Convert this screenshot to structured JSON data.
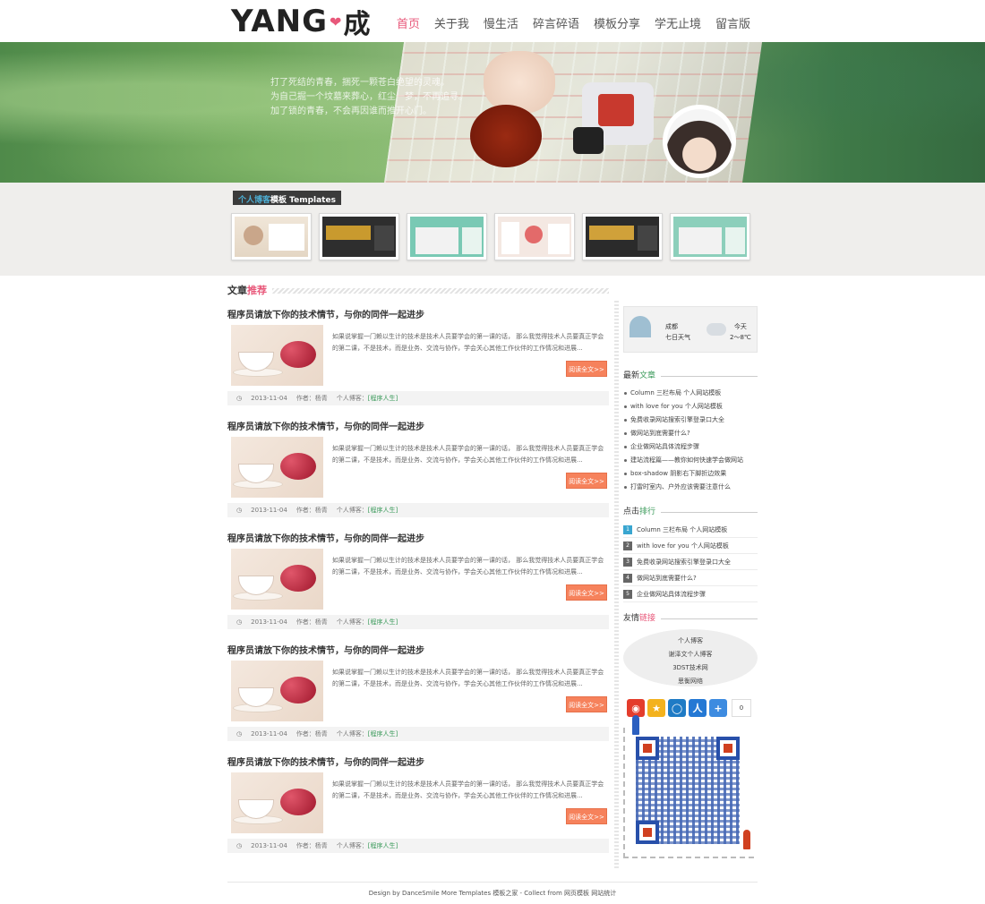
{
  "header": {
    "logo_text": "YANG",
    "logo_cn": "成",
    "nav": [
      "首页",
      "关于我",
      "慢生活",
      "碎言碎语",
      "模板分享",
      "学无止境",
      "留言版"
    ]
  },
  "banner": {
    "lines": [
      "打了死结的青春，捆死一颗苍白绝望的灵魂。",
      "为自己掘一个坟墓来葬心，红尘一梦，不再追寻。",
      "加了锁的青春，不会再因谁而推开心门。"
    ]
  },
  "templates": {
    "title_hl": "个人博客",
    "title_rest": "模板 Templates"
  },
  "articles": {
    "title_main": "文章",
    "title_hl": "推荐",
    "read_more": "阅读全文>>",
    "items": [
      {
        "title": "程序员请放下你的技术情节，与你的同伴一起进步",
        "excerpt": "如果说掌握一门赖以生计的技术是技术人员要学会的第一课的话， 那么我觉得技术人员要真正学会的第二课，不是技术，而是业务、交流与协作，学会关心其他工作伙伴的工作情况和进展...",
        "date": "2013-11-04",
        "author": "作者：杨青",
        "category_label": "个人博客：",
        "category": "[程序人生]"
      },
      {
        "title": "程序员请放下你的技术情节，与你的同伴一起进步",
        "excerpt": "如果说掌握一门赖以生计的技术是技术人员要学会的第一课的话， 那么我觉得技术人员要真正学会的第二课，不是技术，而是业务、交流与协作，学会关心其他工作伙伴的工作情况和进展...",
        "date": "2013-11-04",
        "author": "作者：杨青",
        "category_label": "个人博客：",
        "category": "[程序人生]"
      },
      {
        "title": "程序员请放下你的技术情节，与你的同伴一起进步",
        "excerpt": "如果说掌握一门赖以生计的技术是技术人员要学会的第一课的话， 那么我觉得技术人员要真正学会的第二课，不是技术，而是业务、交流与协作，学会关心其他工作伙伴的工作情况和进展...",
        "date": "2013-11-04",
        "author": "作者：杨青",
        "category_label": "个人博客：",
        "category": "[程序人生]"
      },
      {
        "title": "程序员请放下你的技术情节，与你的同伴一起进步",
        "excerpt": "如果说掌握一门赖以生计的技术是技术人员要学会的第一课的话， 那么我觉得技术人员要真正学会的第二课，不是技术，而是业务、交流与协作，学会关心其他工作伙伴的工作情况和进展...",
        "date": "2013-11-04",
        "author": "作者：杨青",
        "category_label": "个人博客：",
        "category": "[程序人生]"
      },
      {
        "title": "程序员请放下你的技术情节，与你的同伴一起进步",
        "excerpt": "如果说掌握一门赖以生计的技术是技术人员要学会的第一课的话， 那么我觉得技术人员要真正学会的第二课，不是技术，而是业务、交流与协作，学会关心其他工作伙伴的工作情况和进展...",
        "date": "2013-11-04",
        "author": "作者：杨青",
        "category_label": "个人博客：",
        "category": "[程序人生]"
      }
    ]
  },
  "weather": {
    "city": "成都",
    "range": "七日天气",
    "today": "今天",
    "temp": "2～8℃"
  },
  "latest": {
    "title_main": "最新",
    "title_hl": "文章",
    "items": [
      "Column 三栏布局 个人网站模板",
      "with love for you 个人网站模板",
      "免费收录网站搜索引擎登录口大全",
      "做网站到底需要什么?",
      "企业做网站具体流程步骤",
      "建站流程篇——教你如何快速学会做网站",
      "box-shadow 阴影右下脚折边效果",
      "打雷时室内、户外应该需要注意什么"
    ]
  },
  "ranking": {
    "title_main": "点击",
    "title_hl": "排行",
    "items": [
      {
        "num": "1",
        "label": "Column 三栏布局 个人网站模板"
      },
      {
        "num": "2",
        "label": "with love for you 个人网站模板"
      },
      {
        "num": "3",
        "label": "免费收录网站搜索引擎登录口大全"
      },
      {
        "num": "4",
        "label": "做网站到底需要什么?"
      },
      {
        "num": "5",
        "label": "企业做网站具体流程步骤"
      }
    ]
  },
  "friends": {
    "title_main": "友情",
    "title_hl": "链接",
    "items": [
      "个人博客",
      "谢泽文个人博客",
      "3DST技术网",
      "思衡网络"
    ]
  },
  "share": {
    "count": "0"
  },
  "footer": {
    "text": "Design by DanceSmile More Templates 模板之家 - Collect from 网页模板 网站统计"
  },
  "colors": {
    "accent": "#e8587a",
    "more_btn": "#f6825c",
    "green": "#3a9a5a",
    "blue": "#3aa6d0"
  }
}
